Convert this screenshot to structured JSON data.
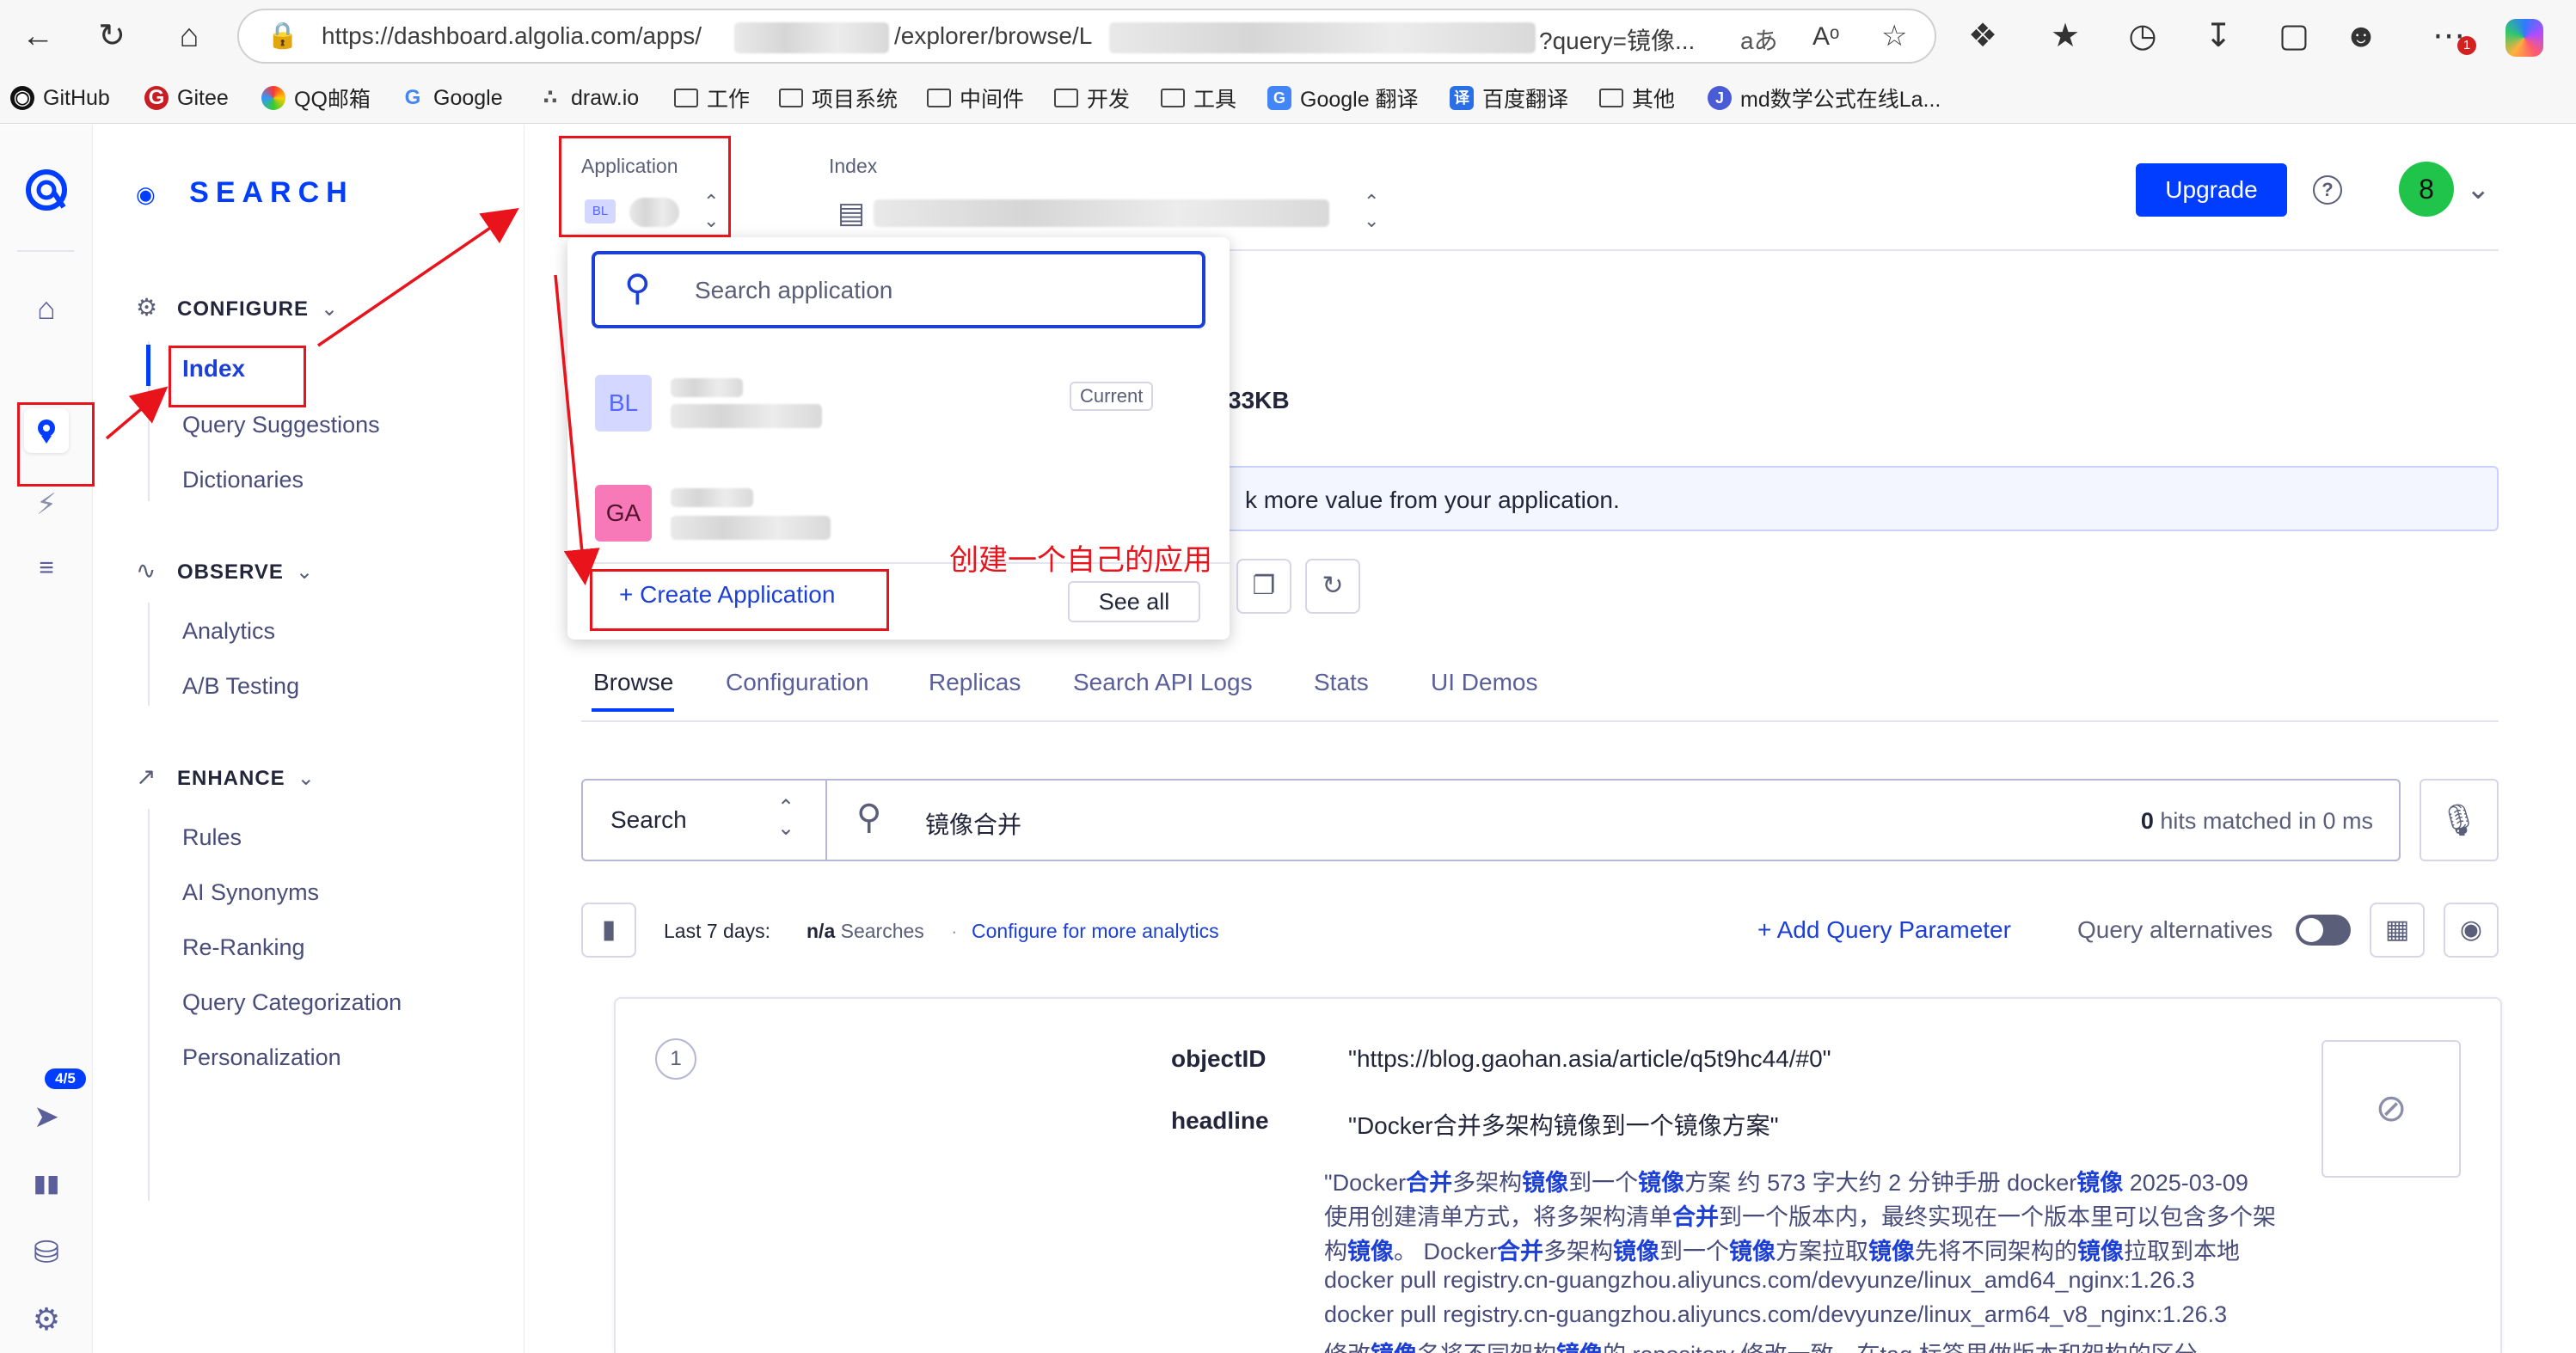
{
  "browser": {
    "url_prefix": "https://dashboard.algolia.com/apps/",
    "url_middle": "/explorer/browse/L",
    "url_suffix": "?query=镜像...",
    "read_aloud": "aあ",
    "bookmarks": [
      {
        "label": "GitHub"
      },
      {
        "label": "Gitee"
      },
      {
        "label": "QQ邮箱"
      },
      {
        "label": "Google"
      },
      {
        "label": "draw.io"
      },
      {
        "label": "工作"
      },
      {
        "label": "项目系统"
      },
      {
        "label": "中间件"
      },
      {
        "label": "开发"
      },
      {
        "label": "工具"
      },
      {
        "label": "Google 翻译"
      },
      {
        "label": "百度翻译"
      },
      {
        "label": "其他"
      },
      {
        "label": "md数学公式在线La..."
      }
    ],
    "ext_badge": "1"
  },
  "rail": {
    "launch_badge": "4/5"
  },
  "sidebar": {
    "brand": "SEARCH",
    "configure": {
      "title": "CONFIGURE",
      "items": [
        "Index",
        "Query Suggestions",
        "Dictionaries"
      ]
    },
    "observe": {
      "title": "OBSERVE",
      "items": [
        "Analytics",
        "A/B Testing"
      ]
    },
    "enhance": {
      "title": "ENHANCE",
      "items": [
        "Rules",
        "AI Synonyms",
        "Re-Ranking",
        "Query Categorization",
        "Personalization"
      ]
    }
  },
  "header": {
    "application_label": "Application",
    "application_avatar": "BL",
    "index_label": "Index",
    "upgrade": "Upgrade",
    "user_initial": "8"
  },
  "dropdown": {
    "search_placeholder": "Search application",
    "apps": [
      {
        "initials": "BL",
        "badge": "Current"
      },
      {
        "initials": "GA"
      }
    ],
    "create": "Create Application",
    "see_all": "See all"
  },
  "annotation": {
    "text": "创建一个自己的应用"
  },
  "overview": {
    "size_fragment": "33KB",
    "banner_fragment": "k more value from your application."
  },
  "tabs": [
    "Browse",
    "Configuration",
    "Replicas",
    "Search API Logs",
    "Stats",
    "UI Demos"
  ],
  "search": {
    "mode": "Search",
    "query": "镜像合并",
    "hits_count": "0",
    "hits_text": "hits matched in 0 ms"
  },
  "analytics": {
    "period": "Last 7 days:",
    "searches_value": "n/a",
    "searches_label": "Searches",
    "configure_link": "Configure for more analytics",
    "add_param": "Add Query Parameter",
    "alternatives": "Query alternatives"
  },
  "record": {
    "index": "1",
    "fields": [
      {
        "key": "objectID",
        "value": "\"https://blog.gaohan.asia/article/q5t9hc44/#0\""
      },
      {
        "key": "headline",
        "value": "\"Docker合并多架构镜像到一个镜像方案\""
      }
    ],
    "snippet_lines": [
      "\"Docker<b>合并</b>多架构<b>镜像</b>到一个<b>镜像</b>方案 约 573 字大约 2 分钟手册 docker<b>镜像</b> 2025-03-09",
      "使用创建清单方式，将多架构清单<b>合并</b>到一个版本内，最终实现在一个版本里可以包含多个架",
      "构<b>镜像</b>。 Docker<b>合并</b>多架构<b>镜像</b>到一个<b>镜像</b>方案拉取<b>镜像</b>先将不同架构的<b>镜像</b>拉取到本地",
      "docker pull registry.cn-guangzhou.aliyuncs.com/devyunze/linux_amd64_nginx:1.26.3",
      "docker pull registry.cn-guangzhou.aliyuncs.com/devyunze/linux_arm64_v8_nginx:1.26.3",
      "修改<b>镜像</b>名将不同架构<b>镜像</b>的 repository 修改一致，在tag 标签里做版本和架构的区分"
    ]
  }
}
